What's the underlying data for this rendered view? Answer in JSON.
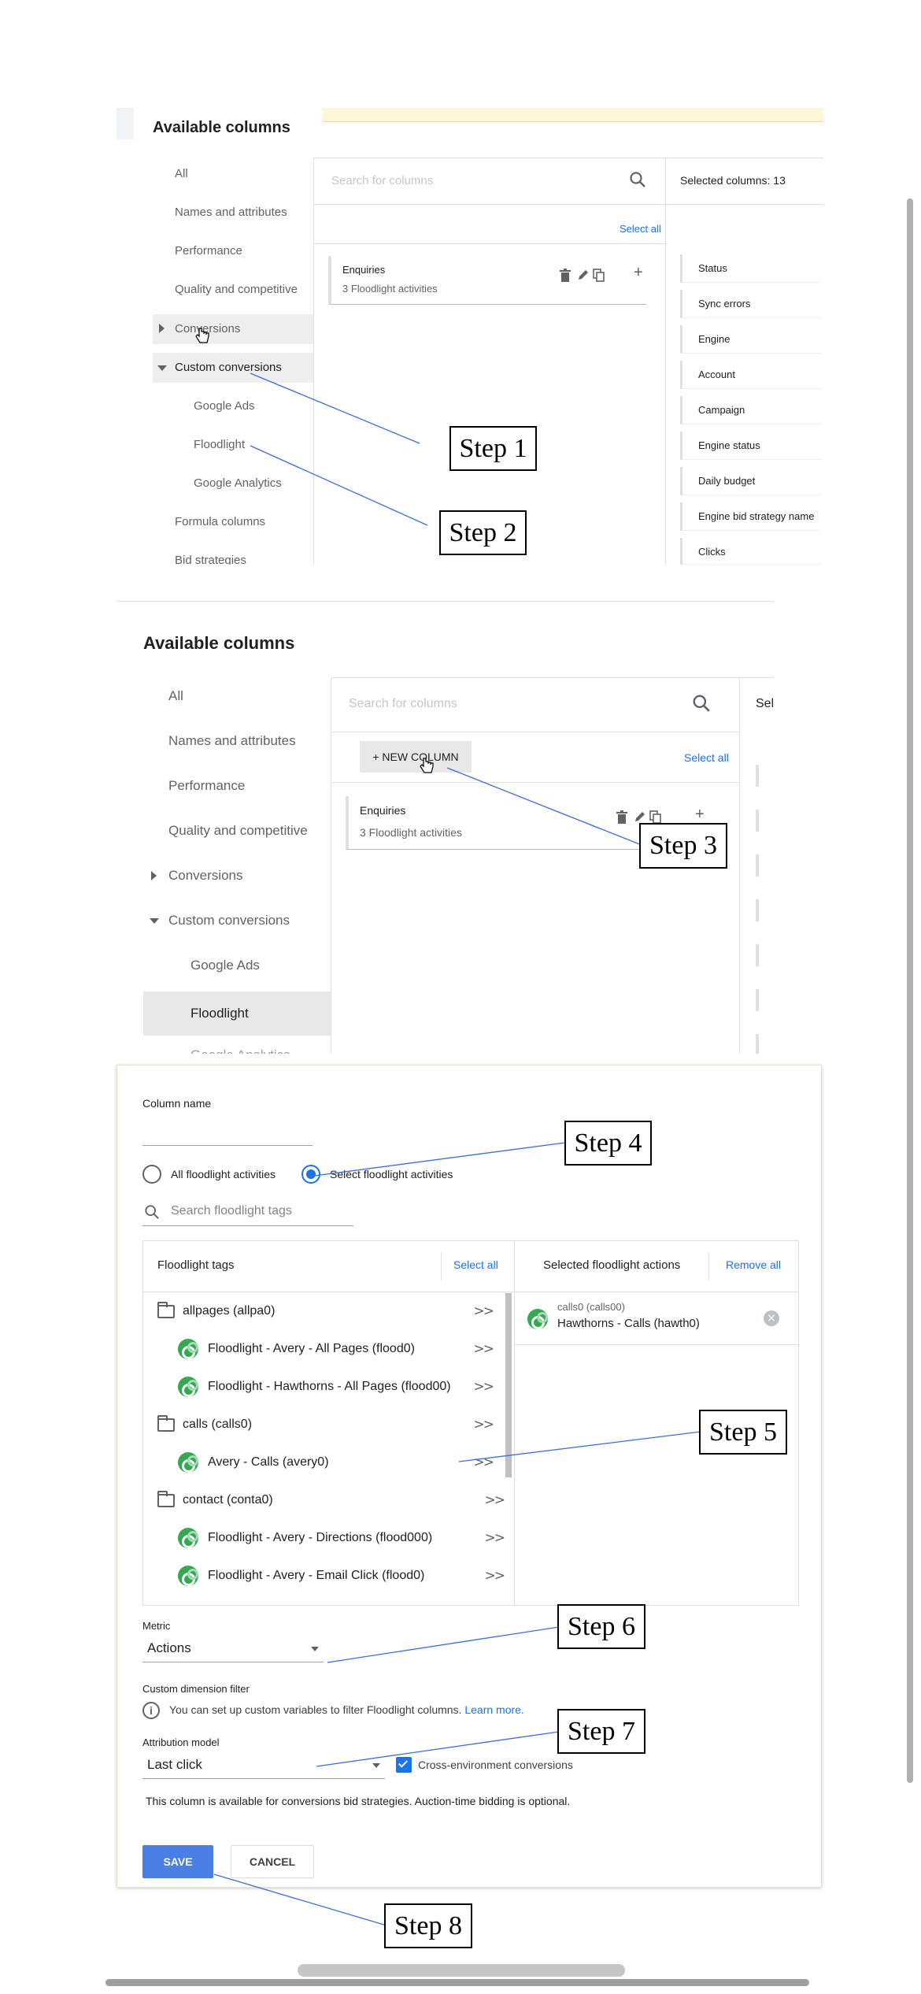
{
  "panel1": {
    "title": "Available columns",
    "nav": [
      "All",
      "Names and attributes",
      "Performance",
      "Quality and competitive",
      "Conversions",
      "Custom conversions",
      "Google Ads",
      "Floodlight",
      "Google Analytics",
      "Formula columns",
      "Bid strategies"
    ],
    "search_placeholder": "Search for columns",
    "select_all": "Select all",
    "column_card": {
      "title": "Enquiries",
      "subtitle": "3 Floodlight activities"
    },
    "selected_header": "Selected columns: 13",
    "selected_columns": [
      "Status",
      "Sync errors",
      "Engine",
      "Account",
      "Campaign",
      "Engine status",
      "Daily budget",
      "Engine bid strategy name",
      "Clicks"
    ]
  },
  "panel2": {
    "title": "Available columns",
    "nav": [
      "All",
      "Names and attributes",
      "Performance",
      "Quality and competitive",
      "Conversions",
      "Custom conversions",
      "Google Ads",
      "Floodlight",
      "Google Analytics"
    ],
    "search_placeholder": "Search for columns",
    "new_column": "+ NEW COLUMN",
    "select_all": "Select all",
    "column_card": {
      "title": "Enquiries",
      "subtitle": "3 Floodlight activities"
    },
    "selected_header_partial": "Sel"
  },
  "panel3": {
    "column_name_label": "Column name",
    "radio_all": "All floodlight activities",
    "radio_select": "Select floodlight activities",
    "search_tags_placeholder": "Search floodlight tags",
    "tags_header": "Floodlight tags",
    "tags_select_all": "Select all",
    "selected_actions_header": "Selected floodlight actions",
    "remove_all": "Remove all",
    "arrow": ">>",
    "tags": [
      {
        "type": "folder",
        "label": "allpages (allpa0)"
      },
      {
        "type": "tag",
        "label": "Floodlight - Avery - All Pages (flood0)"
      },
      {
        "type": "tag",
        "label": "Floodlight - Hawthorns - All Pages (flood00)"
      },
      {
        "type": "folder",
        "label": "calls (calls0)"
      },
      {
        "type": "tag",
        "label": "Avery - Calls (avery0)"
      },
      {
        "type": "folder",
        "label": "contact (conta0)"
      },
      {
        "type": "tag",
        "label": "Floodlight - Avery - Directions (flood000)"
      },
      {
        "type": "tag",
        "label": "Floodlight - Avery - Email Click (flood0)"
      }
    ],
    "selected_action": {
      "group": "calls0 (calls00)",
      "label": "Hawthorns - Calls (hawth0)"
    },
    "metric_label": "Metric",
    "metric_value": "Actions",
    "custom_filter_label": "Custom dimension filter",
    "custom_filter_info": "You can set up custom variables to filter Floodlight columns.",
    "learn_more": "Learn more.",
    "attribution_label": "Attribution model",
    "attribution_value": "Last click",
    "cross_env": "Cross-environment conversions",
    "bid_note": "This column is available for conversions bid strategies. Auction-time bidding is optional.",
    "save": "SAVE",
    "cancel": "CANCEL"
  },
  "steps": [
    "Step 1",
    "Step 2",
    "Step 3",
    "Step 4",
    "Step 5",
    "Step 6",
    "Step 7",
    "Step 8"
  ],
  "colors": {
    "accent": "#1a73e8",
    "save_button": "#4a7fe6",
    "floodlight_green": "#34a853",
    "notice_yellow": "#fef8d6"
  }
}
